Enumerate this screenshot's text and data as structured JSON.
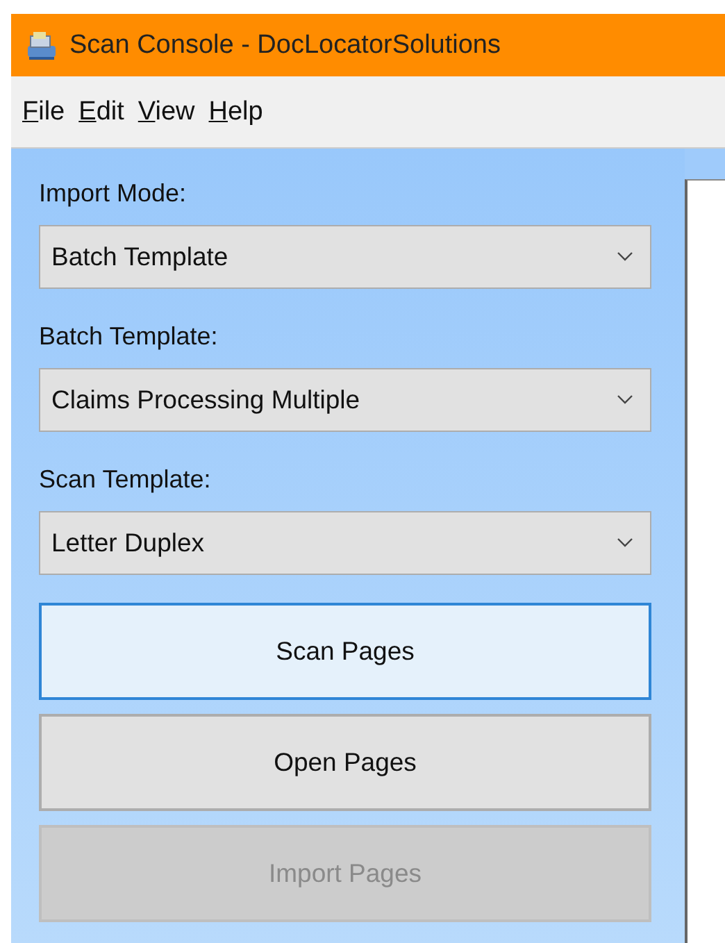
{
  "window": {
    "title": "Scan Console - DocLocatorSolutions"
  },
  "menu": [
    "File",
    "Edit",
    "View",
    "Help"
  ],
  "fields": [
    {
      "label": "Import Mode:",
      "value": "Batch Template"
    },
    {
      "label": "Batch Template:",
      "value": "Claims Processing Multiple"
    },
    {
      "label": "Scan Template:",
      "value": "Letter Duplex"
    }
  ],
  "buttons": [
    {
      "label": "Scan Pages",
      "focused": true,
      "disabled": false
    },
    {
      "label": "Open Pages",
      "focused": false,
      "disabled": false
    },
    {
      "label": "Import Pages",
      "focused": false,
      "disabled": true
    }
  ]
}
